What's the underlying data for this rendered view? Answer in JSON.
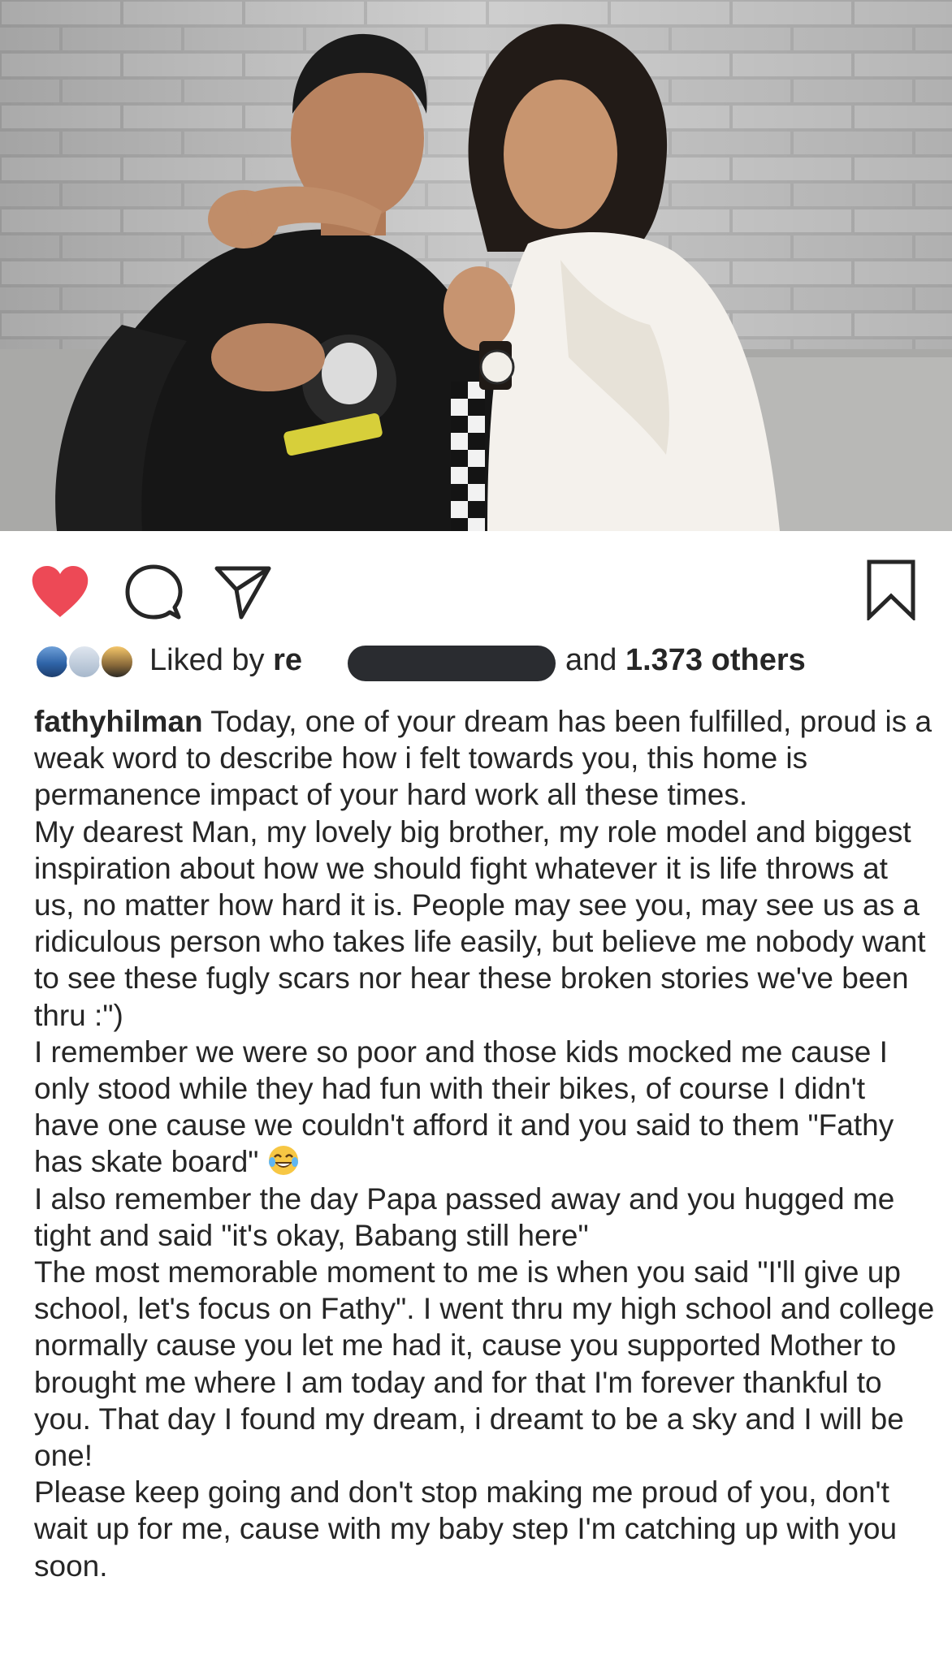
{
  "post": {
    "photo_description_icon": "couple-photo",
    "actions": {
      "like_icon": "heart-filled-icon",
      "comment_icon": "comment-icon",
      "share_icon": "paper-plane-icon",
      "save_icon": "bookmark-icon",
      "like_color": "#ed4956"
    },
    "likes": {
      "prefix": "Liked by ",
      "visible_user": "re",
      "middle": "and ",
      "count": "1.373 others"
    },
    "caption": {
      "username": "fathyhilman",
      "paragraphs": [
        " Today, one of your dream has been fulfilled, proud is a weak word to describe how i felt towards you, this home is permanence impact of your hard work all these times.",
        "My dearest Man, my lovely big brother, my role model and biggest inspiration about how we should fight whatever it is life throws at us, no matter how hard it is. People may see you, may see us as a ridiculous person who takes life easily, but believe me nobody want to see these fugly scars nor hear these broken stories we've been thru :\")",
        "I remember we were so poor and those kids mocked me cause I only stood while they had fun with their bikes, of course I didn't have one cause we couldn't afford it and you said to them \"Fathy has skate board\" ",
        "I also remember the day Papa passed away and you hugged me tight and said \"it's okay, Babang still here\"",
        "The most memorable moment to me is when you said \"I'll give up school, let's focus on Fathy\". I went thru my high school and college normally cause you let me had it, cause you supported Mother to brought me where I am today and for that I'm forever thankful to you. That day I found my dream, i dreamt to be a sky and I will be one!",
        "Please keep going and don't stop making me proud of you, don't wait up for me, cause with my baby step I'm catching up with you soon."
      ],
      "emoji_icon": "laughing-tears-emoji-icon"
    }
  }
}
